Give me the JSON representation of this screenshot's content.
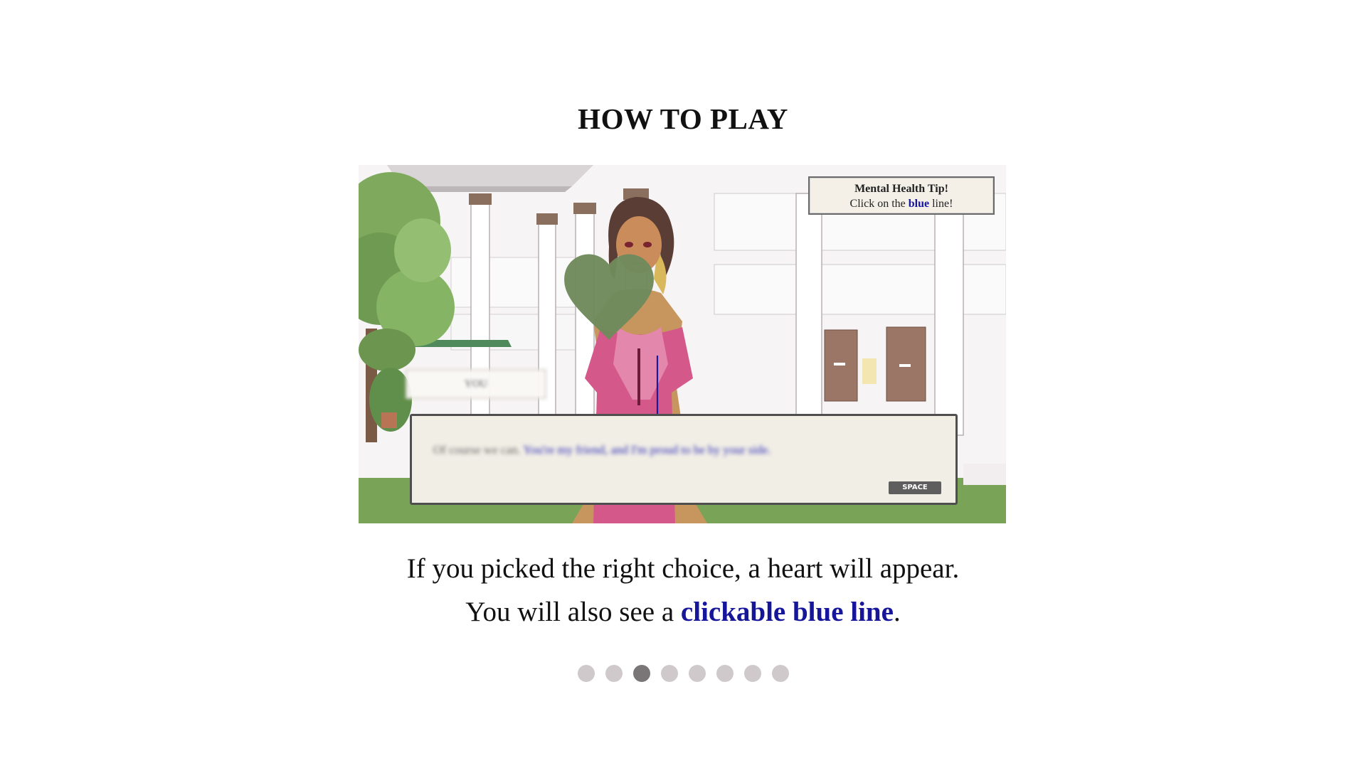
{
  "page": {
    "title": "HOW TO PLAY"
  },
  "screenshot": {
    "tip": {
      "title": "Mental Health Tip!",
      "prefix": "Click on the ",
      "highlight": "blue",
      "suffix": " line!"
    },
    "name_box": "YOU",
    "dialogue": {
      "plain": "Of course we can. ",
      "highlight": "You're my friend, and I'm proud to be by your side."
    },
    "space_button": "SPACE"
  },
  "caption": {
    "line1": "If you picked the right choice, a heart will appear.",
    "line2_prefix": "You will also see a ",
    "line2_link": "clickable blue line",
    "line2_suffix": "."
  },
  "pagination": {
    "total": 8,
    "current": 3
  },
  "colors": {
    "link": "#16169a",
    "heart": "#6f8a5c",
    "dot": "#cfc9cb",
    "dot_active": "#7a7577"
  }
}
